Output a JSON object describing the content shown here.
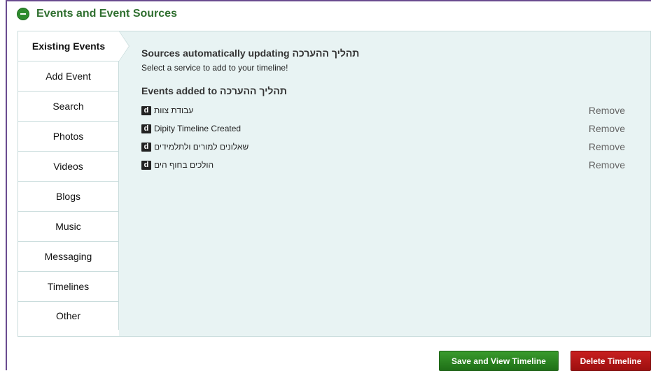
{
  "header": {
    "title": "Events and Event Sources",
    "collapse_icon": "minus-circle-icon"
  },
  "tabs": [
    {
      "label": "Existing Events",
      "active": true
    },
    {
      "label": "Add Event"
    },
    {
      "label": "Search"
    },
    {
      "label": "Photos"
    },
    {
      "label": "Videos"
    },
    {
      "label": "Blogs"
    },
    {
      "label": "Music"
    },
    {
      "label": "Messaging"
    },
    {
      "label": "Timelines"
    },
    {
      "label": "Other"
    }
  ],
  "content": {
    "sources_heading": "Sources automatically updating תהליך ההערכה",
    "sources_text": "Select a service to add to your timeline!",
    "events_heading": "Events added to תהליך ההערכה",
    "events": [
      {
        "name": "עבודת צוות",
        "action": "Remove"
      },
      {
        "name": "Dipity Timeline Created",
        "action": "Remove"
      },
      {
        "name": "שאלונים למורים ולתלמידים",
        "action": "Remove"
      },
      {
        "name": "הולכים בחוף הים",
        "action": "Remove"
      }
    ],
    "event_icon_text": "d"
  },
  "buttons": {
    "save": "Save and View Timeline",
    "delete": "Delete Timeline"
  },
  "colors": {
    "frame": "#6a4b8f",
    "header": "#2f6f2f",
    "panel": "#e8f3f3",
    "save_button": "#2e8b2e",
    "delete_button": "#b81515"
  }
}
